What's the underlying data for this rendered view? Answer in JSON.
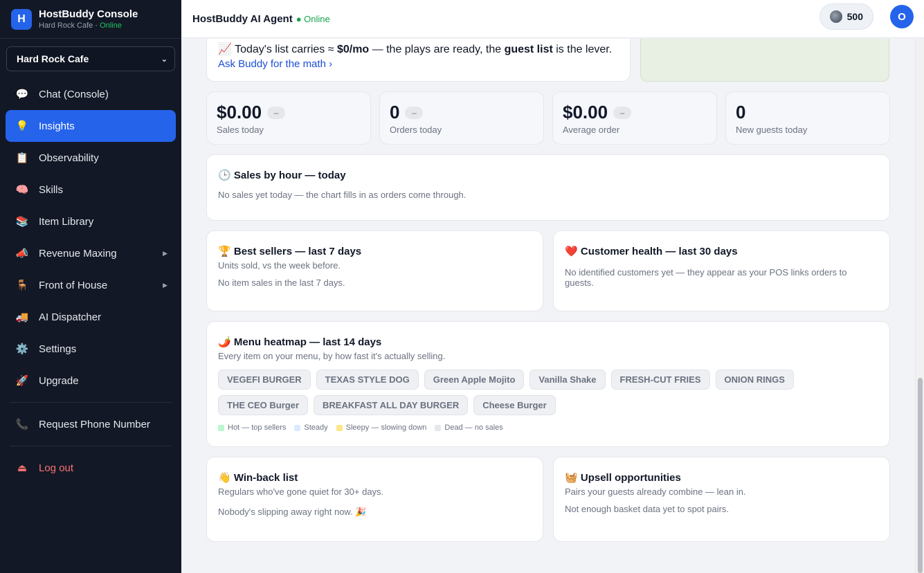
{
  "brand": {
    "logo_letter": "H",
    "title": "HostBuddy Console",
    "venue": "Hard Rock Cafe",
    "separator": "·",
    "status": "Online"
  },
  "venue_select": {
    "value": "Hard Rock Cafe",
    "chevron": "⌄"
  },
  "nav": {
    "items": [
      {
        "icon": "💬",
        "icon_name": "chat-icon",
        "label": "Chat (Console)"
      },
      {
        "icon": "💡",
        "icon_name": "lightbulb-icon",
        "label": "Insights",
        "active": true
      },
      {
        "icon": "📋",
        "icon_name": "clipboard-icon",
        "label": "Observability"
      },
      {
        "icon": "🧠",
        "icon_name": "brain-icon",
        "label": "Skills"
      },
      {
        "icon": "📚",
        "icon_name": "books-icon",
        "label": "Item Library"
      },
      {
        "icon": "📣",
        "icon_name": "megaphone-icon",
        "label": "Revenue Maxing",
        "has_submenu": true
      },
      {
        "icon": "🪑",
        "icon_name": "chair-icon",
        "label": "Front of House",
        "has_submenu": true
      },
      {
        "icon": "🚚",
        "icon_name": "truck-icon",
        "label": "AI Dispatcher"
      },
      {
        "icon": "⚙️",
        "icon_name": "gear-icon",
        "label": "Settings"
      },
      {
        "icon": "🚀",
        "icon_name": "rocket-icon",
        "label": "Upgrade"
      }
    ],
    "phone": {
      "icon": "📞",
      "label": "Request Phone Number"
    },
    "logout": {
      "icon": "⏏",
      "label": "Log out"
    }
  },
  "topbar": {
    "agent_title": "HostBuddy AI Agent",
    "agent_status": "● Online",
    "credits": "500",
    "avatar_letter": "O"
  },
  "lever": {
    "icon": "📈",
    "prefix": "Today's list carries ≈ ",
    "amount": "$0/mo",
    "middle": " — the plays are ready, the ",
    "emphasis": "guest list",
    "suffix": " is the lever.",
    "link": "Ask Buddy for the math ›"
  },
  "stats": [
    {
      "value": "$0.00",
      "delta": "–",
      "label": "Sales today"
    },
    {
      "value": "0",
      "delta": "–",
      "label": "Orders today"
    },
    {
      "value": "$0.00",
      "delta": "–",
      "label": "Average order"
    },
    {
      "value": "0",
      "delta": "",
      "label": "New guests today"
    }
  ],
  "sales_by_hour": {
    "icon": "🕒",
    "title": "Sales by hour — today",
    "empty": "No sales yet today — the chart fills in as orders come through."
  },
  "best_sellers": {
    "icon": "🏆",
    "title": "Best sellers — last 7 days",
    "subtitle": "Units sold, vs the week before.",
    "empty": "No item sales in the last 7 days."
  },
  "customer_health": {
    "icon": "❤️",
    "title": "Customer health — last 30 days",
    "empty": "No identified customers yet — they appear as your POS links orders to guests."
  },
  "menu_heatmap": {
    "icon": "🌶️",
    "title": "Menu heatmap — last 14 days",
    "subtitle": "Every item on your menu, by how fast it's actually selling.",
    "items": [
      "VEGEFI BURGER",
      "TEXAS STYLE DOG",
      "Green Apple Mojito",
      "Vanilla Shake",
      "FRESH-CUT FRIES",
      "ONION RINGS",
      "THE CEO Burger",
      "BREAKFAST ALL DAY BURGER",
      "Cheese Burger"
    ],
    "legend": [
      {
        "label": "Hot — top sellers",
        "color": "#bbf7d0"
      },
      {
        "label": "Steady",
        "color": "#dbeafe"
      },
      {
        "label": "Sleepy — slowing down",
        "color": "#fde68a"
      },
      {
        "label": "Dead — no sales",
        "color": "#e5e7eb"
      }
    ]
  },
  "win_back": {
    "icon": "👋",
    "title": "Win-back list",
    "subtitle": "Regulars who've gone quiet for 30+ days.",
    "empty": "Nobody's slipping away right now. 🎉"
  },
  "upsell": {
    "icon": "🧺",
    "title": "Upsell opportunities",
    "subtitle": "Pairs your guests already combine — lean in.",
    "empty": "Not enough basket data yet to spot pairs."
  },
  "colors": {
    "sidebar_bg": "#121826",
    "accent": "#2563eb",
    "online": "#22c55e",
    "logout": "#f87171",
    "link": "#1d4ed8"
  }
}
